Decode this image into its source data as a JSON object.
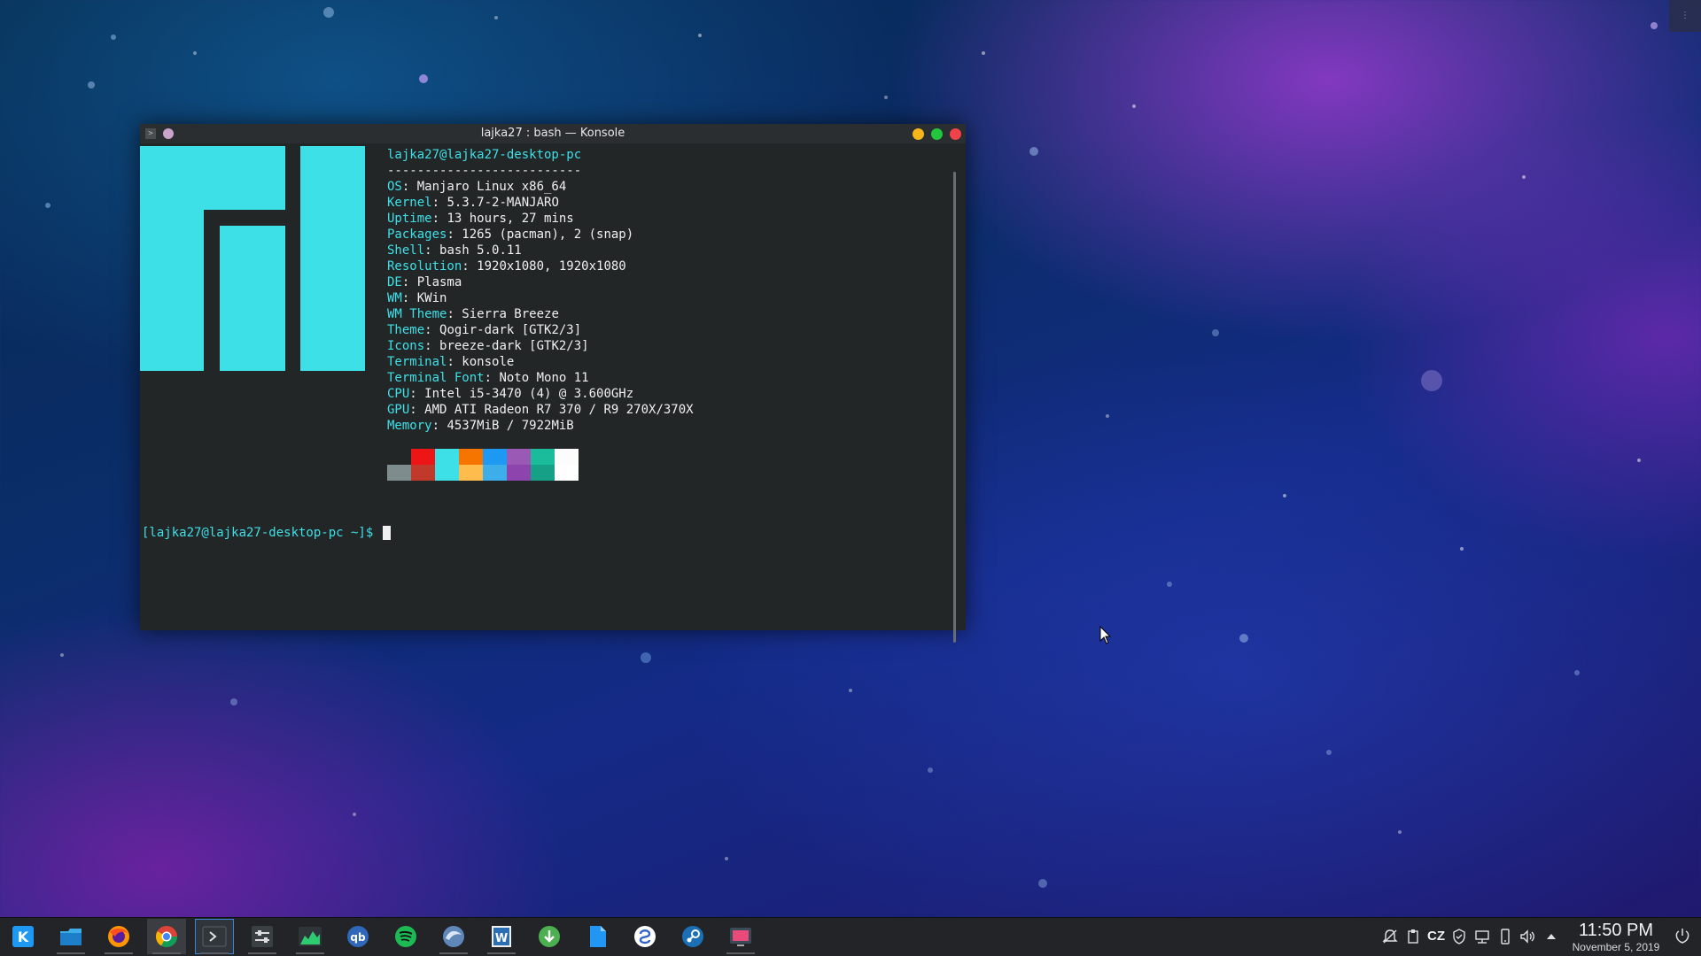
{
  "window": {
    "title": "lajka27 : bash — Konsole",
    "menu_glyph": ">"
  },
  "neofetch": {
    "header": "lajka27@lajka27-desktop-pc",
    "separator": "--------------------------",
    "fields": [
      {
        "key": "OS",
        "value": "Manjaro Linux x86_64"
      },
      {
        "key": "Kernel",
        "value": "5.3.7-2-MANJARO"
      },
      {
        "key": "Uptime",
        "value": "13 hours, 27 mins"
      },
      {
        "key": "Packages",
        "value": "1265 (pacman), 2 (snap)"
      },
      {
        "key": "Shell",
        "value": "bash 5.0.11"
      },
      {
        "key": "Resolution",
        "value": "1920x1080, 1920x1080"
      },
      {
        "key": "DE",
        "value": "Plasma"
      },
      {
        "key": "WM",
        "value": "KWin"
      },
      {
        "key": "WM Theme",
        "value": "Sierra Breeze"
      },
      {
        "key": "Theme",
        "value": "Qogir-dark [GTK2/3]"
      },
      {
        "key": "Icons",
        "value": "breeze-dark [GTK2/3]"
      },
      {
        "key": "Terminal",
        "value": "konsole"
      },
      {
        "key": "Terminal Font",
        "value": "Noto Mono 11"
      },
      {
        "key": "CPU",
        "value": "Intel i5-3470 (4) @ 3.600GHz"
      },
      {
        "key": "GPU",
        "value": "AMD ATI Radeon R7 370 / R9 270X/370X"
      },
      {
        "key": "Memory",
        "value": "4537MiB / 7922MiB"
      }
    ],
    "palette": [
      {
        "top": "#232627",
        "bottom": "#7f8c8d"
      },
      {
        "top": "#ed1515",
        "bottom": "#c0392b"
      },
      {
        "top": "#3ee0e8",
        "bottom": "#3ee0e8"
      },
      {
        "top": "#f67400",
        "bottom": "#fdbc4b"
      },
      {
        "top": "#1d99f3",
        "bottom": "#3daee9"
      },
      {
        "top": "#9b59b6",
        "bottom": "#8e44ad"
      },
      {
        "top": "#1abc9c",
        "bottom": "#16a085"
      },
      {
        "top": "#fcfcfc",
        "bottom": "#ffffff"
      }
    ],
    "logo_color": "#3ee0e8"
  },
  "prompt": {
    "text": "[lajka27@lajka27-desktop-pc ~]$"
  },
  "taskbar": {
    "apps": [
      {
        "name": "application-launcher-icon"
      },
      {
        "name": "file-manager-icon"
      },
      {
        "name": "firefox-icon"
      },
      {
        "name": "chrome-icon"
      },
      {
        "name": "konsole-icon"
      },
      {
        "name": "system-settings-icon"
      },
      {
        "name": "system-monitor-icon"
      },
      {
        "name": "qbittorrent-icon"
      },
      {
        "name": "spotify-icon"
      },
      {
        "name": "wireshark-icon"
      },
      {
        "name": "writer-icon"
      },
      {
        "name": "downloader-icon"
      },
      {
        "name": "document-icon"
      },
      {
        "name": "simplenote-icon"
      },
      {
        "name": "steam-icon"
      },
      {
        "name": "screen-recorder-icon"
      }
    ],
    "tray": {
      "language": "CZ",
      "time": "11:50 PM",
      "date": "November 5, 2019"
    }
  }
}
